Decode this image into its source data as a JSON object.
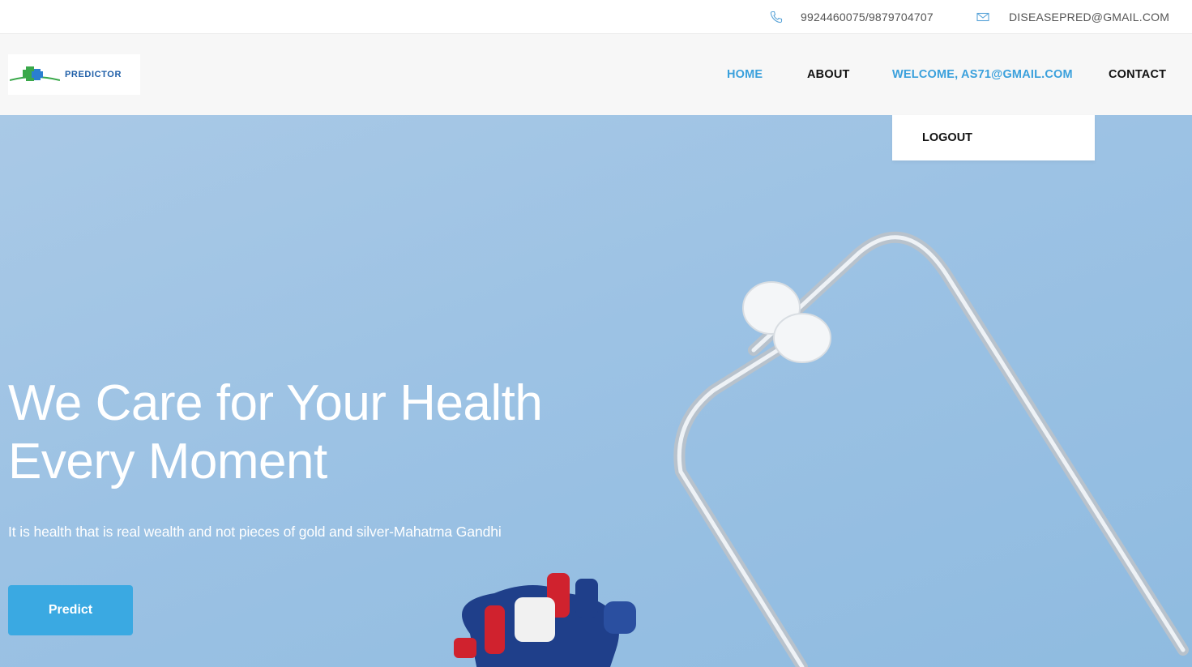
{
  "topbar": {
    "phone": "9924460075/9879704707",
    "email": "DISEASEPRED@GMAIL.COM",
    "phone_icon": "phone-icon",
    "email_icon": "envelope-icon"
  },
  "header": {
    "logo_text": "PREDICTOR",
    "nav": {
      "home": "HOME",
      "about": "ABOUT",
      "welcome": "WELCOME, AS71@GMAIL.COM",
      "contact": "CONTACT"
    },
    "dropdown": {
      "logout": "LOGOUT"
    }
  },
  "hero": {
    "headline_line1": "We Care for Your Health",
    "headline_line2": "Every Moment",
    "quote": "It is health that is real wealth and not pieces of gold and silver-Mahatma Gandhi",
    "button": "Predict"
  },
  "colors": {
    "accent": "#3aa0dc",
    "button": "#3aa9e2",
    "hero_bg": "#9cc2e4",
    "nav_bg": "#f7f7f7"
  }
}
